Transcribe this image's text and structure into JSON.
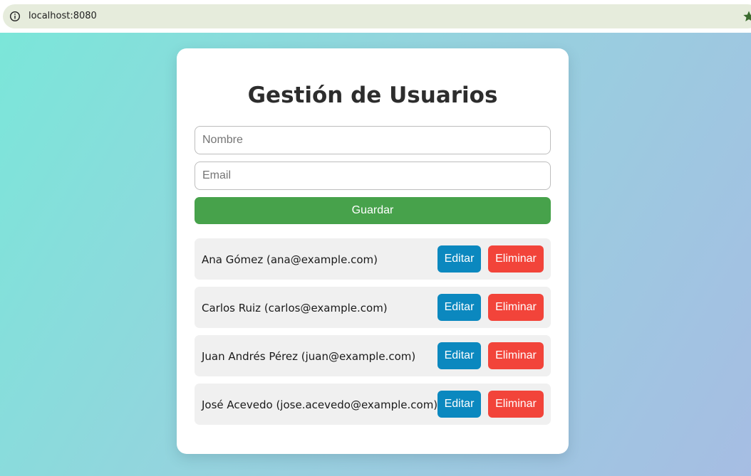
{
  "browser": {
    "url": "localhost:8080",
    "info_icon": "info-icon",
    "bookmark_icon": "star-icon"
  },
  "app": {
    "title": "Gestión de Usuarios",
    "form": {
      "name_placeholder": "Nombre",
      "email_placeholder": "Email",
      "save_label": "Guardar"
    },
    "users": [
      {
        "text": "Ana Gómez (ana@example.com)",
        "edit_label": "Editar",
        "delete_label": "Eliminar"
      },
      {
        "text": "Carlos Ruiz (carlos@example.com)",
        "edit_label": "Editar",
        "delete_label": "Eliminar"
      },
      {
        "text": "Juan Andrés Pérez (juan@example.com)",
        "edit_label": "Editar",
        "delete_label": "Eliminar"
      },
      {
        "text": "José Acevedo (jose.acevedo@example.com)",
        "edit_label": "Editar",
        "delete_label": "Eliminar"
      }
    ]
  },
  "colors": {
    "save_button": "#47a24b",
    "edit_button": "#0b88bf",
    "delete_button": "#f2443a",
    "address_bar": "#e6ecdc",
    "bookmark_star": "#3a6b2e"
  }
}
